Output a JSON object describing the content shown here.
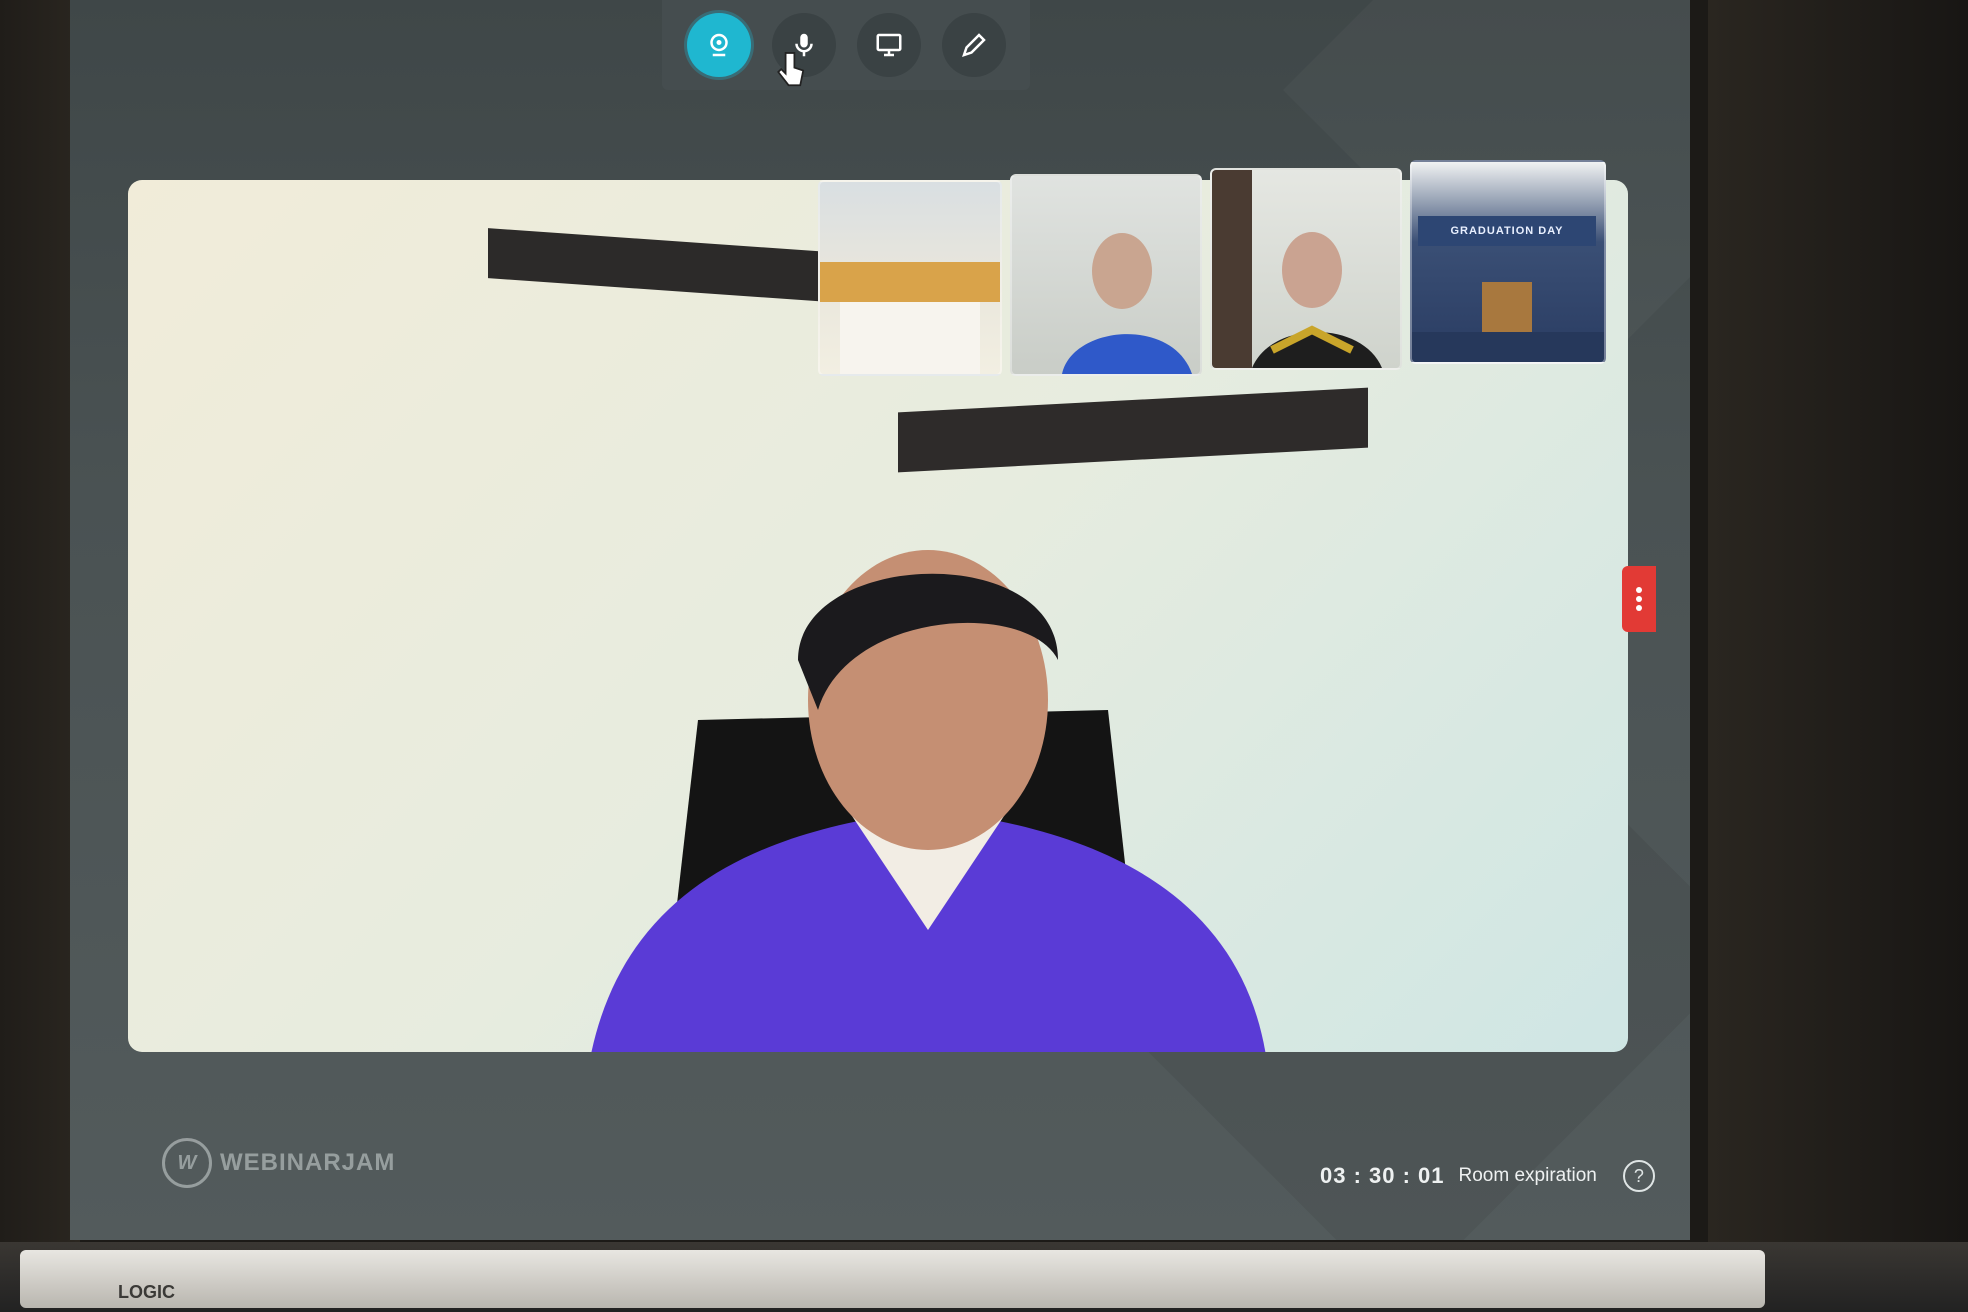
{
  "toolbar": {
    "buttons": [
      {
        "name": "webcam",
        "icon": "webcam-icon",
        "active": true
      },
      {
        "name": "microphone",
        "icon": "microphone-icon",
        "active": false
      },
      {
        "name": "screen-share",
        "icon": "monitor-icon",
        "active": false
      },
      {
        "name": "whiteboard",
        "icon": "pencil-icon",
        "active": false
      }
    ]
  },
  "thumbnails": [
    {
      "name": "participant-1"
    },
    {
      "name": "participant-2"
    },
    {
      "name": "participant-3"
    },
    {
      "name": "participant-4",
      "banner": "GRADUATION DAY"
    }
  ],
  "footer": {
    "brand": "WEBINARJAM",
    "timer": "03 : 30 : 01",
    "expiry_label": "Room expiration",
    "help": "?"
  },
  "colors": {
    "accent": "#1fb7d0",
    "menu_button": "#e23a35",
    "background": "#4a5253"
  },
  "monitor_label": "LOGIC"
}
